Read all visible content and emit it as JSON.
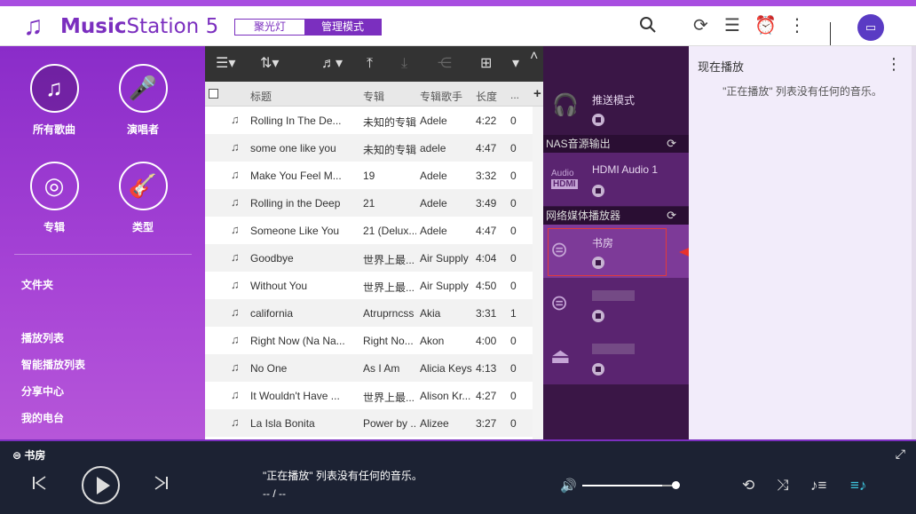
{
  "app": {
    "name_bold": "Music",
    "name_rest": "Station 5",
    "mode_spotlight": "聚光灯",
    "mode_admin": "管理模式"
  },
  "topbar_icons": [
    "search-icon",
    "refresh-icon",
    "list-icon",
    "alarm-icon",
    "more-icon"
  ],
  "sidebar": {
    "categories": [
      {
        "label": "所有歌曲",
        "icon": "music-note-icon"
      },
      {
        "label": "演唱者",
        "icon": "artist-icon"
      },
      {
        "label": "专辑",
        "icon": "album-icon"
      },
      {
        "label": "类型",
        "icon": "guitar-icon"
      }
    ],
    "links": [
      "文件夹",
      "播放列表",
      "智能播放列表",
      "分享中心",
      "我的电台"
    ]
  },
  "tracklist": {
    "columns": {
      "title": "标题",
      "album": "专辑",
      "artist": "专辑歌手",
      "length": "长度",
      "plays": "..."
    },
    "rows": [
      {
        "title": "Rolling In The De...",
        "album": "未知的专辑",
        "artist": "Adele",
        "length": "4:22",
        "plays": "0"
      },
      {
        "title": "some one like you",
        "album": "未知的专辑",
        "artist": "adele",
        "length": "4:47",
        "plays": "0"
      },
      {
        "title": "Make You Feel M...",
        "album": "19",
        "artist": "Adele",
        "length": "3:32",
        "plays": "0"
      },
      {
        "title": "Rolling in the Deep",
        "album": "21",
        "artist": "Adele",
        "length": "3:49",
        "plays": "0"
      },
      {
        "title": "Someone Like You",
        "album": "21 (Delux...",
        "artist": "Adele",
        "length": "4:47",
        "plays": "0"
      },
      {
        "title": "Goodbye",
        "album": "世界上最...",
        "artist": "Air Supply",
        "length": "4:04",
        "plays": "0"
      },
      {
        "title": "Without You",
        "album": "世界上最...",
        "artist": "Air Supply",
        "length": "4:50",
        "plays": "0"
      },
      {
        "title": "california",
        "album": "Atruprncss",
        "artist": "Akia",
        "length": "3:31",
        "plays": "1"
      },
      {
        "title": "Right Now (Na Na...",
        "album": "Right No...",
        "artist": "Akon",
        "length": "4:00",
        "plays": "0"
      },
      {
        "title": "No One",
        "album": "As I Am",
        "artist": "Alicia Keys",
        "length": "4:13",
        "plays": "0"
      },
      {
        "title": "It Wouldn't Have ...",
        "album": "世界上最...",
        "artist": "Alison Kr...",
        "length": "4:27",
        "plays": "0"
      },
      {
        "title": "La Isla Bonita",
        "album": "Power by ...",
        "artist": "Alizee",
        "length": "3:27",
        "plays": "0"
      }
    ]
  },
  "devices": {
    "push_mode": "推送模式",
    "nas_section": "NAS音源输出",
    "hdmi_name": "HDMI Audio 1",
    "hdmi_icon_top": "Audio",
    "hdmi_icon_bottom": "HDMI",
    "network_section": "网络媒体播放器",
    "selected_player": "书房"
  },
  "now_playing": {
    "title": "现在播放",
    "empty_message": "\"正在播放\" 列表没有任何的音乐。"
  },
  "player": {
    "device": "书房",
    "message": "\"正在播放\" 列表没有任何的音乐。",
    "time": "-- / --",
    "volume": 0.85
  }
}
